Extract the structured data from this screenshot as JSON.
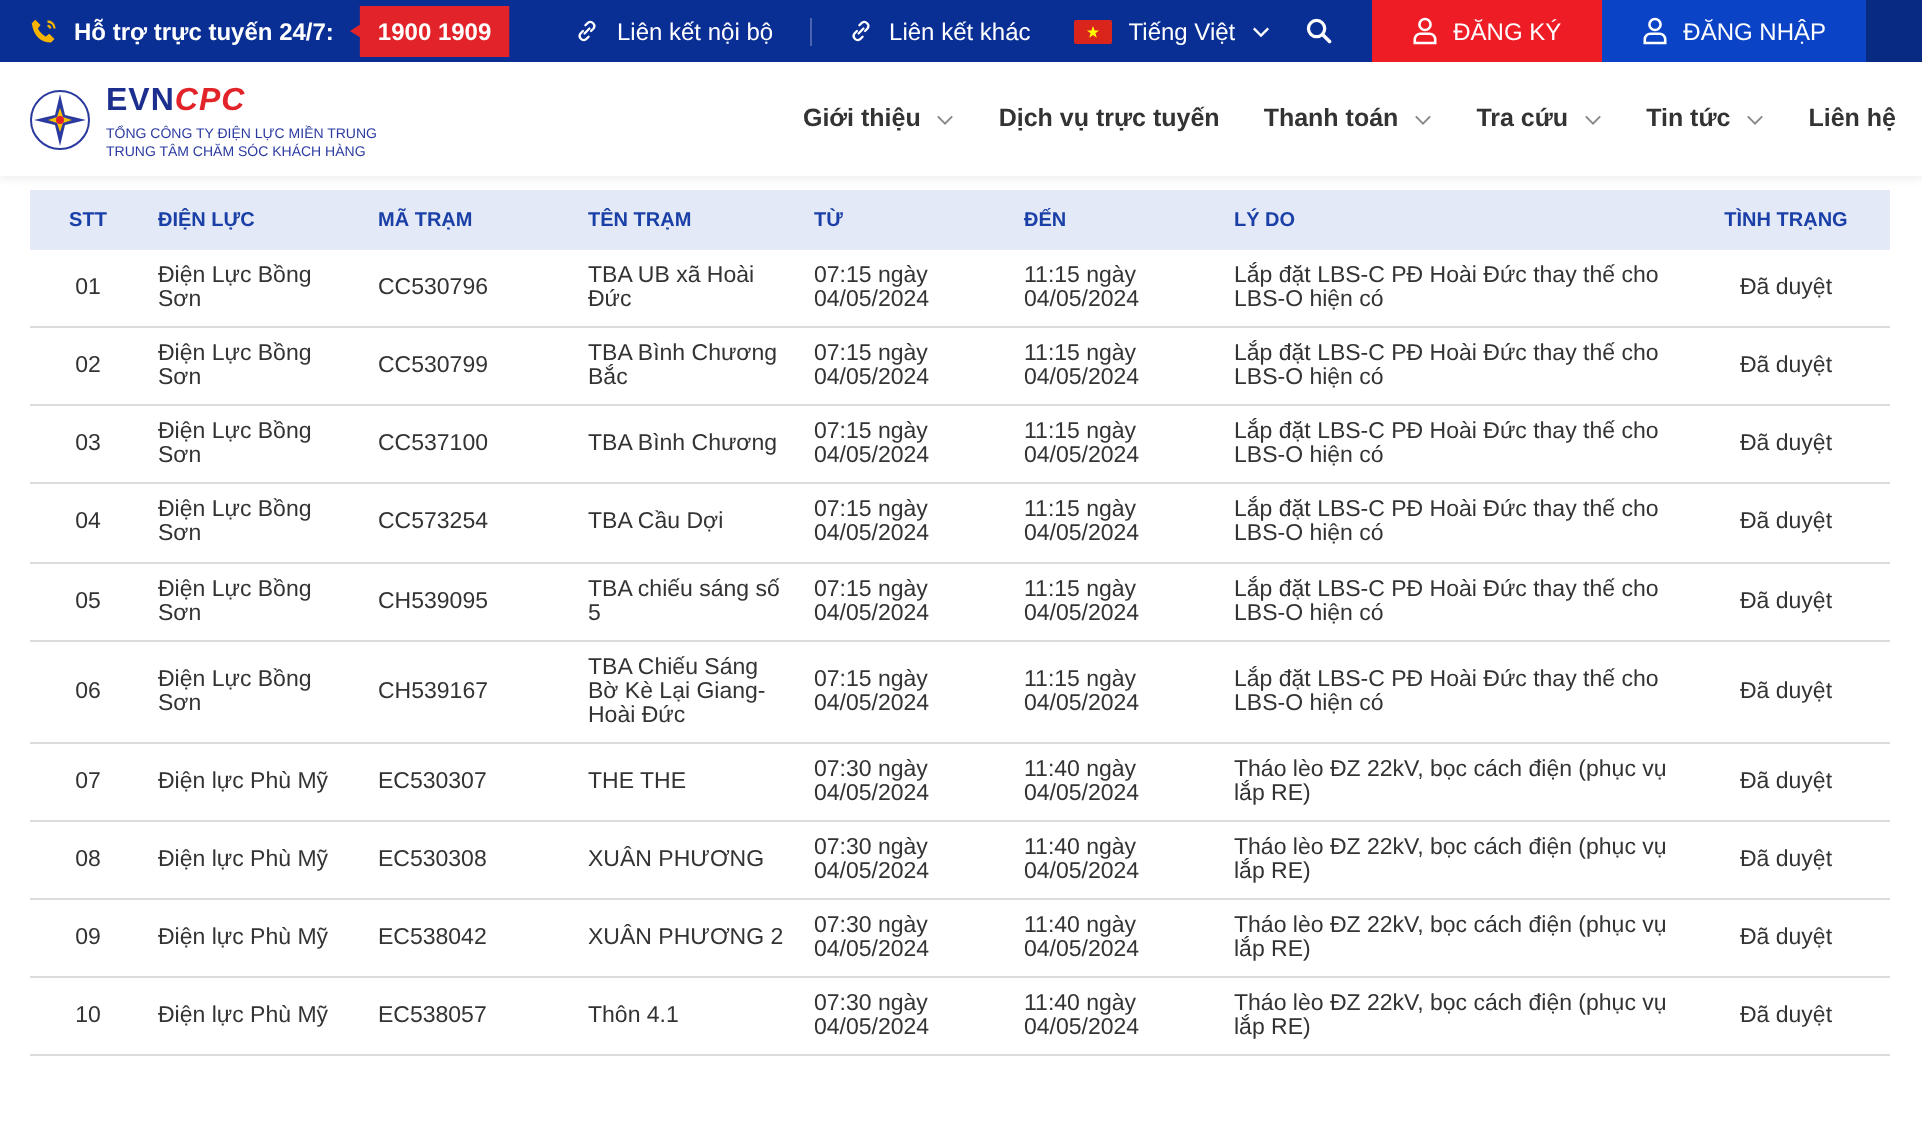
{
  "topbar": {
    "support_label": "Hỗ trợ trực tuyến 24/7:",
    "hotline": "1900 1909",
    "links": [
      {
        "label": "Liên kết nội bộ"
      },
      {
        "label": "Liên kết khác"
      }
    ],
    "language": "Tiếng Việt",
    "register": "ĐĂNG KÝ",
    "login": "ĐĂNG NHẬP"
  },
  "logo": {
    "brand_left": "EVN",
    "brand_right": "CPC",
    "line_1": "TỔNG CÔNG TY ĐIỆN LỰC MIỀN TRUNG",
    "line_2": "TRUNG TÂM CHĂM SÓC KHÁCH HÀNG"
  },
  "nav": [
    {
      "label": "Giới thiệu",
      "has_dropdown": true
    },
    {
      "label": "Dịch vụ trực tuyến",
      "has_dropdown": false
    },
    {
      "label": "Thanh toán",
      "has_dropdown": true
    },
    {
      "label": "Tra cứu",
      "has_dropdown": true
    },
    {
      "label": "Tin tức",
      "has_dropdown": true
    },
    {
      "label": "Liên hệ",
      "has_dropdown": false
    }
  ],
  "table": {
    "columns": [
      "STT",
      "ĐIỆN LỰC",
      "MÃ TRẠM",
      "TÊN TRẠM",
      "TỪ",
      "ĐẾN",
      "LÝ DO",
      "TÌNH TRẠNG"
    ],
    "rows": [
      [
        "01",
        "Điện Lực Bồng Sơn",
        "CC530796",
        "TBA UB xã Hoài Đức",
        "07:15 ngày 04/05/2024",
        "11:15 ngày 04/05/2024",
        "Lắp đặt LBS-C PĐ Hoài Đức thay thế cho LBS-O hiện có",
        "Đã duyệt"
      ],
      [
        "02",
        "Điện Lực Bồng Sơn",
        "CC530799",
        "TBA Bình Chương Bắc",
        "07:15 ngày 04/05/2024",
        "11:15 ngày 04/05/2024",
        "Lắp đặt LBS-C PĐ Hoài Đức thay thế cho LBS-O hiện có",
        "Đã duyệt"
      ],
      [
        "03",
        "Điện Lực Bồng Sơn",
        "CC537100",
        "TBA Bình Chương",
        "07:15 ngày 04/05/2024",
        "11:15 ngày 04/05/2024",
        "Lắp đặt LBS-C PĐ Hoài Đức thay thế cho LBS-O hiện có",
        "Đã duyệt"
      ],
      [
        "04",
        "Điện Lực Bồng Sơn",
        "CC573254",
        "TBA Cầu Dợi",
        "07:15 ngày 04/05/2024",
        "11:15 ngày 04/05/2024",
        "Lắp đặt LBS-C PĐ Hoài Đức thay thế cho LBS-O hiện có",
        "Đã duyệt"
      ],
      [
        "05",
        "Điện Lực Bồng Sơn",
        "CH539095",
        "TBA chiếu sáng số 5",
        "07:15 ngày 04/05/2024",
        "11:15 ngày 04/05/2024",
        "Lắp đặt LBS-C PĐ Hoài Đức thay thế cho LBS-O hiện có",
        "Đã duyệt"
      ],
      [
        "06",
        "Điện Lực Bồng Sơn",
        "CH539167",
        "TBA Chiếu Sáng Bờ Kè Lại Giang-Hoài Đức",
        "07:15 ngày 04/05/2024",
        "11:15 ngày 04/05/2024",
        "Lắp đặt LBS-C PĐ Hoài Đức thay thế cho LBS-O hiện có",
        "Đã duyệt"
      ],
      [
        "07",
        "Điện lực Phù Mỹ",
        "EC530307",
        "THE THE",
        "07:30 ngày 04/05/2024",
        "11:40 ngày 04/05/2024",
        "Tháo lèo ĐZ 22kV, bọc cách điện (phục vụ lắp RE)",
        "Đã duyệt"
      ],
      [
        "08",
        "Điện lực Phù Mỹ",
        "EC530308",
        "XUÂN PHƯƠNG",
        "07:30 ngày 04/05/2024",
        "11:40 ngày 04/05/2024",
        "Tháo lèo ĐZ 22kV, bọc cách điện (phục vụ lắp RE)",
        "Đã duyệt"
      ],
      [
        "09",
        "Điện lực Phù Mỹ",
        "EC538042",
        "XUÂN PHƯƠNG 2",
        "07:30 ngày 04/05/2024",
        "11:40 ngày 04/05/2024",
        "Tháo lèo ĐZ 22kV, bọc cách điện (phục vụ lắp RE)",
        "Đã duyệt"
      ],
      [
        "10",
        "Điện lực Phù Mỹ",
        "EC538057",
        "Thôn 4.1",
        "07:30 ngày 04/05/2024",
        "11:40 ngày 04/05/2024",
        "Tháo lèo ĐZ 22kV, bọc cách điện (phục vụ lắp RE)",
        "Đã duyệt"
      ]
    ]
  }
}
